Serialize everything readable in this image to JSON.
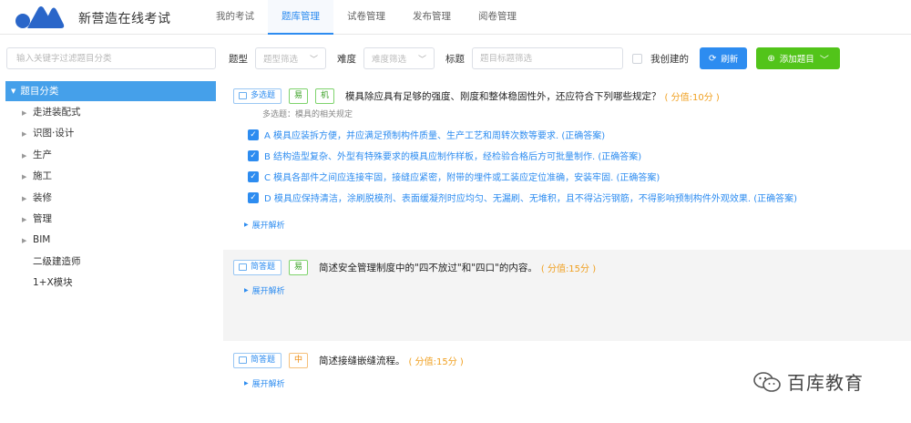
{
  "app": {
    "title": "新营造在线考试"
  },
  "nav": [
    {
      "label": "我的考试",
      "active": false
    },
    {
      "label": "题库管理",
      "active": true
    },
    {
      "label": "试卷管理",
      "active": false
    },
    {
      "label": "发布管理",
      "active": false
    },
    {
      "label": "阅卷管理",
      "active": false
    }
  ],
  "sidebar": {
    "search_placeholder": "输入关键字过滤题目分类",
    "root_label": "题目分类",
    "items": [
      {
        "label": "走进装配式",
        "expandable": true
      },
      {
        "label": "识图·设计",
        "expandable": true
      },
      {
        "label": "生产",
        "expandable": true
      },
      {
        "label": "施工",
        "expandable": true
      },
      {
        "label": "装修",
        "expandable": true
      },
      {
        "label": "管理",
        "expandable": true
      },
      {
        "label": "BIM",
        "expandable": true
      },
      {
        "label": "二级建造师",
        "expandable": false
      },
      {
        "label": "1+X模块",
        "expandable": false
      }
    ]
  },
  "filters": {
    "type_label": "题型",
    "type_placeholder": "题型筛选",
    "difficulty_label": "难度",
    "difficulty_placeholder": "难度筛选",
    "title_label": "标题",
    "title_placeholder": "题目标题筛选",
    "mine_label": "我创建的",
    "refresh_label": "刷新",
    "add_label": "添加题目"
  },
  "questions": [
    {
      "type": "多选题",
      "tags": [
        "易",
        "机"
      ],
      "title": "模具除应具有足够的强度、刚度和整体稳固性外，还应符合下列哪些规定？",
      "score": "( 分值:10分 )",
      "sub": "多选题：模具的相关规定",
      "options": [
        "A 模具应装拆方便，并应满足预制构件质量、生产工艺和周转次数等要求. (正确答案)",
        "B 结构造型复杂、外型有特殊要求的模具应制作样板，经检验合格后方可批量制作. (正确答案)",
        "C 模具各部件之间应连接牢固，接缝应紧密，附带的埋件或工装应定位准确，安装牢固. (正确答案)",
        "D 模具应保持清洁，涂刷脱模剂、表面缓凝剂时应均匀、无漏刷、无堆积，且不得沾污钢筋，不得影响预制构件外观效果. (正确答案)"
      ],
      "expand": "展开解析"
    },
    {
      "type": "简答题",
      "tags": [
        "易"
      ],
      "title": "简述安全管理制度中的\"四不放过\"和\"四口\"的内容。",
      "score": "( 分值:15分 )",
      "expand": "展开解析"
    },
    {
      "type": "简答题",
      "tags": [
        "中"
      ],
      "title": "简述接缝嵌缝流程。",
      "score": "( 分值:15分 )",
      "expand": "展开解析"
    }
  ],
  "watermark": {
    "text": "百库教育"
  },
  "colors": {
    "primary": "#2d8cf0",
    "success": "#52c41a",
    "score": "#f0a020",
    "tree_active": "#45a0ea"
  }
}
